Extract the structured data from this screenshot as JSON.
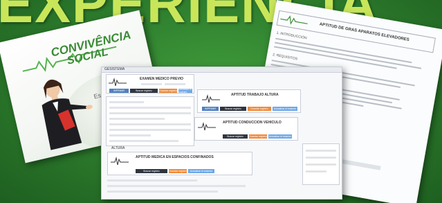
{
  "headline": "EXPERIENCIA",
  "slide": {
    "title_line1": "CONVIVÊNCIA",
    "title_line2": "SOCIAL",
    "tagline": "Estamos"
  },
  "doc": {
    "header_title": "APTITUD DE GRAS APARATOS ELEVADORES",
    "lines": [
      "1. INTRODUCCIÓN",
      "2. REQUISITOS"
    ]
  },
  "shot": {
    "topbar": "GESISTEMA",
    "panels": {
      "p1_title": "EXAMEN MEDICO PREVIO",
      "p2_title": "APTITUD TRABAJO ALTURA",
      "p3_title": "APTITUD CONDUCCION VEHICULO",
      "p4_title": "APTITUD MEDICA EN ESPACIOS CONFINADOS",
      "p5_title": "ALTURA"
    },
    "buttons": {
      "b1": "IMPRIMIR",
      "b2": "Buscar registro",
      "b3": "Guardar registro",
      "b4": "Actualizar el examen"
    }
  },
  "colors": {
    "background": "#2c7a2c",
    "headline": "#c9e65a",
    "brand_green": "#3a8b36",
    "button_dark": "#2f3640",
    "button_orange": "#f08a3a",
    "button_blue": "#4f7fc0"
  }
}
